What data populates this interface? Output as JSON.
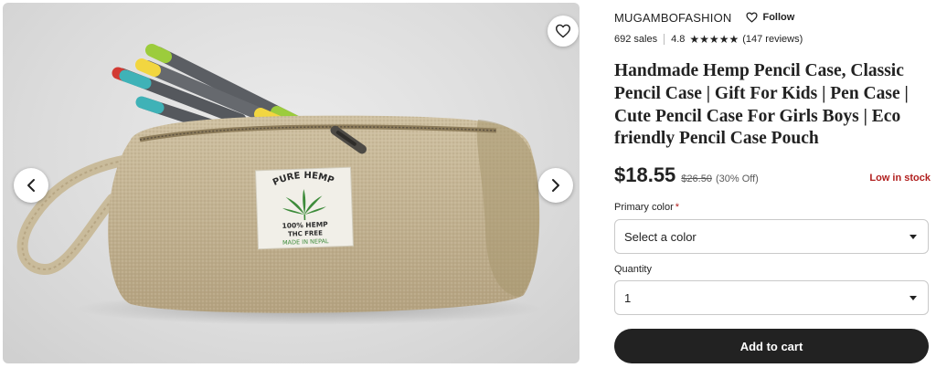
{
  "gallery": {
    "favorite_icon": "heart-outline-icon",
    "prev_icon": "chevron-left-icon",
    "next_icon": "chevron-right-icon",
    "label_text": [
      "PURE HEMP",
      "100% HEMP",
      "THC FREE",
      "MADE IN NEPAL"
    ]
  },
  "shop": {
    "name": "MUGAMBOFASHION",
    "follow_label": "Follow",
    "follow_icon": "heart-outline-icon"
  },
  "stats": {
    "sales": "692 sales",
    "rating": "4.8",
    "stars": 5,
    "reviews": "(147 reviews)"
  },
  "product": {
    "title": "Handmade Hemp Pencil Case, Classic Pencil Case | Gift For Kids | Pen Case | Cute Pencil Case For Girls Boys | Eco friendly Pencil Case Pouch",
    "price": "$18.55",
    "original_price": "$26.50",
    "discount": "(30% Off)",
    "stock_status": "Low in stock"
  },
  "options": {
    "color_label": "Primary color",
    "color_required_marker": "*",
    "color_value": "Select a color",
    "quantity_label": "Quantity",
    "quantity_value": "1"
  },
  "actions": {
    "add_to_cart_label": "Add to cart"
  },
  "colors": {
    "text": "#222222",
    "low_stock": "#b1201f",
    "button_bg": "#222222"
  }
}
